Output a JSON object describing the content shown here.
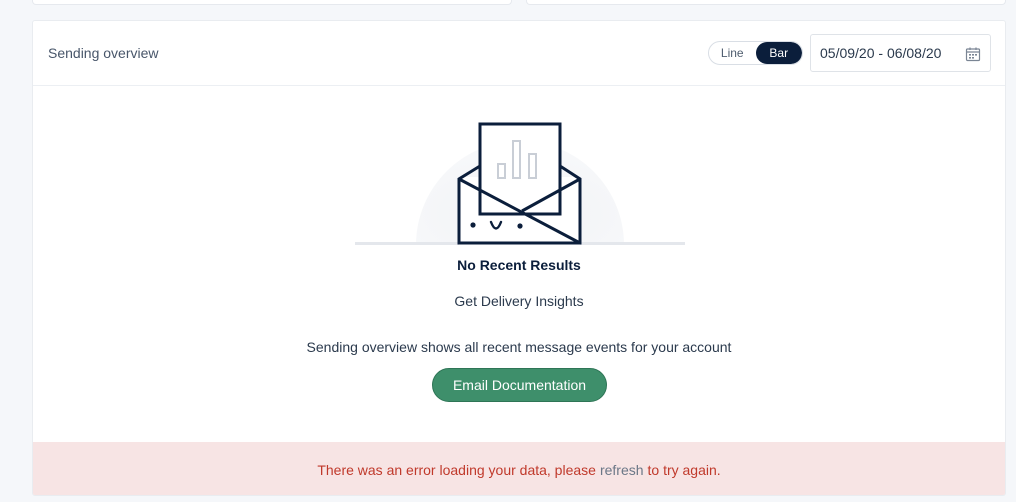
{
  "panel": {
    "title": "Sending overview",
    "chart_toggle": {
      "options": [
        "Line",
        "Bar"
      ],
      "selected": "Bar"
    },
    "date_range": "05/09/20 - 06/08/20"
  },
  "empty_state": {
    "title": "No Recent Results",
    "subtitle": "Get Delivery Insights",
    "description": "Sending overview shows all recent message events for your account",
    "button_label": "Email Documentation",
    "illustration_icon": "envelope-chart-icon"
  },
  "error": {
    "text_before": "There was an error loading your data, please",
    "link": "refresh",
    "text_after": "to try again."
  },
  "colors": {
    "accent_dark": "#0b1e3b",
    "button_green": "#3e8f6b",
    "error_bg": "#f7e4e4",
    "error_text": "#c0392b"
  }
}
